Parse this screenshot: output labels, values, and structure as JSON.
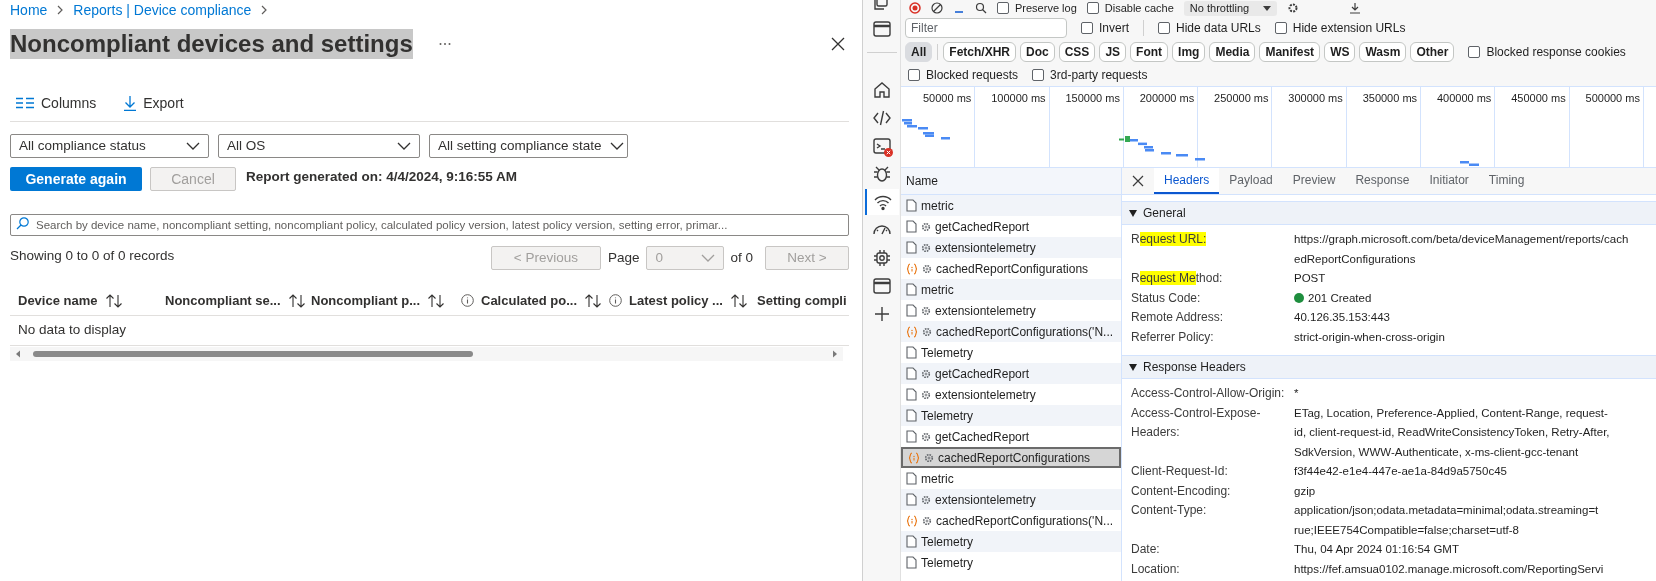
{
  "breadcrumb": [
    {
      "label": "Home"
    },
    {
      "label": "Reports | Device compliance"
    }
  ],
  "title": "Noncompliant devices and settings",
  "title_highlighted": true,
  "toolbar": [
    {
      "kind": "columns",
      "label": "Columns"
    },
    {
      "kind": "export",
      "label": "Export"
    }
  ],
  "filters": [
    {
      "value": "All compliance status"
    },
    {
      "value": "All OS"
    },
    {
      "value": "All setting compliance state"
    }
  ],
  "actions": [
    {
      "kind": "primary",
      "label": "Generate again",
      "disabled": false
    },
    {
      "kind": "secondary",
      "label": "Cancel",
      "disabled": true
    }
  ],
  "report_generated": "Report generated on: 4/4/2024, 9:16:55 AM",
  "search": {
    "placeholder": "Search by device name, noncompliant setting, noncompliant policy, calculated policy version, latest policy version, setting error, primar..."
  },
  "record_count": "Showing 0 to 0 of 0 records",
  "pager": {
    "previous": {
      "label": "< Previous",
      "disabled": true
    },
    "page_label": "Page",
    "page_value": "0",
    "page_disabled": true,
    "page_count": "of 0",
    "next": {
      "label": "Next >",
      "disabled": true
    }
  },
  "table": {
    "columns": [
      {
        "label": "Device name",
        "info": false
      },
      {
        "label": "Noncompliant se...",
        "info": false
      },
      {
        "label": "Noncompliant p...",
        "info": false
      },
      {
        "label": "Calculated po...",
        "info": true
      },
      {
        "label": "Latest policy ...",
        "info": true
      },
      {
        "label": "Setting compli",
        "info": false
      }
    ],
    "empty_message": "No data to display"
  },
  "devtools": {
    "sidebar": [
      {
        "kind": "copy",
        "selected": false,
        "badge": false
      },
      {
        "kind": "window",
        "selected": false,
        "badge": false
      },
      {
        "kind": "home",
        "selected": false,
        "badge": false
      },
      {
        "kind": "elements",
        "selected": false,
        "badge": false
      },
      {
        "kind": "console",
        "selected": false,
        "badge": true
      },
      {
        "kind": "bug",
        "selected": false,
        "badge": false
      },
      {
        "kind": "network",
        "selected": true,
        "badge": false
      },
      {
        "kind": "performance",
        "selected": false,
        "badge": false
      },
      {
        "kind": "memory",
        "selected": false,
        "badge": false
      },
      {
        "kind": "window",
        "selected": false,
        "badge": false
      },
      {
        "kind": "add",
        "selected": false,
        "badge": false
      }
    ],
    "toolbar": {
      "checkboxes": [
        {
          "label": "Preserve log",
          "checked": false
        },
        {
          "label": "Disable cache",
          "checked": false
        }
      ],
      "throttling": "No throttling"
    },
    "filter": {
      "placeholder": "Filter"
    },
    "filter_options": [
      {
        "label": "Invert",
        "checked": false
      },
      {
        "label": "Hide data URLs",
        "checked": false
      },
      {
        "label": "Hide extension URLs",
        "checked": false
      }
    ],
    "type_filters": [
      {
        "label": "All",
        "selected": true
      },
      {
        "label": "Fetch/XHR",
        "selected": false
      },
      {
        "label": "Doc",
        "selected": false
      },
      {
        "label": "CSS",
        "selected": false
      },
      {
        "label": "JS",
        "selected": false
      },
      {
        "label": "Font",
        "selected": false
      },
      {
        "label": "Img",
        "selected": false
      },
      {
        "label": "Media",
        "selected": false
      },
      {
        "label": "Manifest",
        "selected": false
      },
      {
        "label": "WS",
        "selected": false
      },
      {
        "label": "Wasm",
        "selected": false
      },
      {
        "label": "Other",
        "selected": false
      }
    ],
    "blocked_cookies": {
      "label": "Blocked response cookies",
      "checked": false
    },
    "request_options": [
      {
        "label": "Blocked requests",
        "checked": false
      },
      {
        "label": "3rd-party requests",
        "checked": false
      }
    ],
    "overview_ticks": [
      "50000 ms",
      "100000 ms",
      "150000 ms",
      "200000 ms",
      "250000 ms",
      "300000 ms",
      "350000 ms",
      "400000 ms",
      "450000 ms",
      "500000 ms"
    ],
    "requests": {
      "column": "Name",
      "rows": [
        {
          "name": "metric",
          "kind": "document",
          "gear": false,
          "selected": false
        },
        {
          "name": "getCachedReport",
          "kind": "document",
          "gear": true,
          "selected": false
        },
        {
          "name": "extensiontelemetry",
          "kind": "document",
          "gear": true,
          "selected": false
        },
        {
          "name": "cachedReportConfigurations",
          "kind": "fetch",
          "gear": true,
          "selected": false
        },
        {
          "name": "metric",
          "kind": "document",
          "gear": false,
          "selected": false
        },
        {
          "name": "extensiontelemetry",
          "kind": "document",
          "gear": true,
          "selected": false
        },
        {
          "name": "cachedReportConfigurations('N...",
          "kind": "fetch",
          "gear": true,
          "selected": false
        },
        {
          "name": "Telemetry",
          "kind": "document",
          "gear": false,
          "selected": false
        },
        {
          "name": "getCachedReport",
          "kind": "document",
          "gear": true,
          "selected": false
        },
        {
          "name": "extensiontelemetry",
          "kind": "document",
          "gear": true,
          "selected": false
        },
        {
          "name": "Telemetry",
          "kind": "document",
          "gear": false,
          "selected": false
        },
        {
          "name": "getCachedReport",
          "kind": "document",
          "gear": true,
          "selected": false
        },
        {
          "name": "cachedReportConfigurations",
          "kind": "fetch",
          "gear": true,
          "selected": true
        },
        {
          "name": "metric",
          "kind": "document",
          "gear": false,
          "selected": false
        },
        {
          "name": "extensiontelemetry",
          "kind": "document",
          "gear": true,
          "selected": false
        },
        {
          "name": "cachedReportConfigurations('N...",
          "kind": "fetch",
          "gear": true,
          "selected": false
        },
        {
          "name": "Telemetry",
          "kind": "document",
          "gear": false,
          "selected": false
        },
        {
          "name": "Telemetry",
          "kind": "document",
          "gear": false,
          "selected": false
        }
      ]
    },
    "details": {
      "tabs": [
        {
          "label": "Headers",
          "selected": true
        },
        {
          "label": "Payload",
          "selected": false
        },
        {
          "label": "Preview",
          "selected": false
        },
        {
          "label": "Response",
          "selected": false
        },
        {
          "label": "Initiator",
          "selected": false
        },
        {
          "label": "Timing",
          "selected": false
        }
      ],
      "sections": [
        {
          "title": "General",
          "expanded": true,
          "rows": [
            {
              "kind": "text",
              "name": [
                {
                  "text": "R",
                  "highlight": false
                },
                {
                  "text": "equest URL:",
                  "highlight": true
                }
              ],
              "value": [
                "https://graph.microsoft.com/beta/deviceManagement/reports/cach",
                "edReportConfigurations"
              ]
            },
            {
              "kind": "text",
              "name": [
                {
                  "text": "R",
                  "highlight": false
                },
                {
                  "text": "equest Me",
                  "highlight": true
                },
                {
                  "text": "thod:",
                  "highlight": false
                }
              ],
              "value": [
                "POST"
              ]
            },
            {
              "kind": "status",
              "name": [
                {
                  "text": "Status Code:",
                  "highlight": false
                }
              ],
              "value": [
                "201 Created"
              ]
            },
            {
              "kind": "text",
              "name": [
                {
                  "text": "Remote Address:",
                  "highlight": false
                }
              ],
              "value": [
                "40.126.35.153:443"
              ]
            },
            {
              "kind": "text",
              "name": [
                {
                  "text": "Referrer Policy:",
                  "highlight": false
                }
              ],
              "value": [
                "strict-origin-when-cross-origin"
              ]
            }
          ]
        },
        {
          "title": "Response Headers",
          "expanded": true,
          "rows": [
            {
              "kind": "text",
              "name": [
                {
                  "text": "Access-Control-Allow-Origin:",
                  "highlight": false
                }
              ],
              "value": [
                "*"
              ]
            },
            {
              "kind": "text",
              "name": [
                {
                  "text": "Access-Control-Expose-Headers:",
                  "highlight": false
                }
              ],
              "value": [
                "ETag, Location, Preference-Applied, Content-Range, request-",
                "id, client-request-id, ReadWriteConsistencyToken, Retry-After,",
                "SdkVersion, WWW-Authenticate, x-ms-client-gcc-tenant"
              ]
            },
            {
              "kind": "text",
              "name": [
                {
                  "text": "Client-Request-Id:",
                  "highlight": false
                }
              ],
              "value": [
                "f3f44e42-e1e4-447e-ae1a-84d9a5750c45"
              ]
            },
            {
              "kind": "text",
              "name": [
                {
                  "text": "Content-Encoding:",
                  "highlight": false
                }
              ],
              "value": [
                "gzip"
              ]
            },
            {
              "kind": "text",
              "name": [
                {
                  "text": "Content-Type:",
                  "highlight": false
                }
              ],
              "value": [
                "application/json;odata.metadata=minimal;odata.streaming=t",
                "rue;IEEE754Compatible=false;charset=utf-8"
              ]
            },
            {
              "kind": "text",
              "name": [
                {
                  "text": "Date:",
                  "highlight": false
                }
              ],
              "value": [
                "Thu, 04 Apr 2024 01:16:54 GMT"
              ]
            },
            {
              "kind": "text",
              "name": [
                {
                  "text": "Location:",
                  "highlight": false
                }
              ],
              "value": [
                "https://fef.amsua0102.manage.microsoft.com/ReportingServi"
              ]
            }
          ]
        }
      ]
    }
  }
}
